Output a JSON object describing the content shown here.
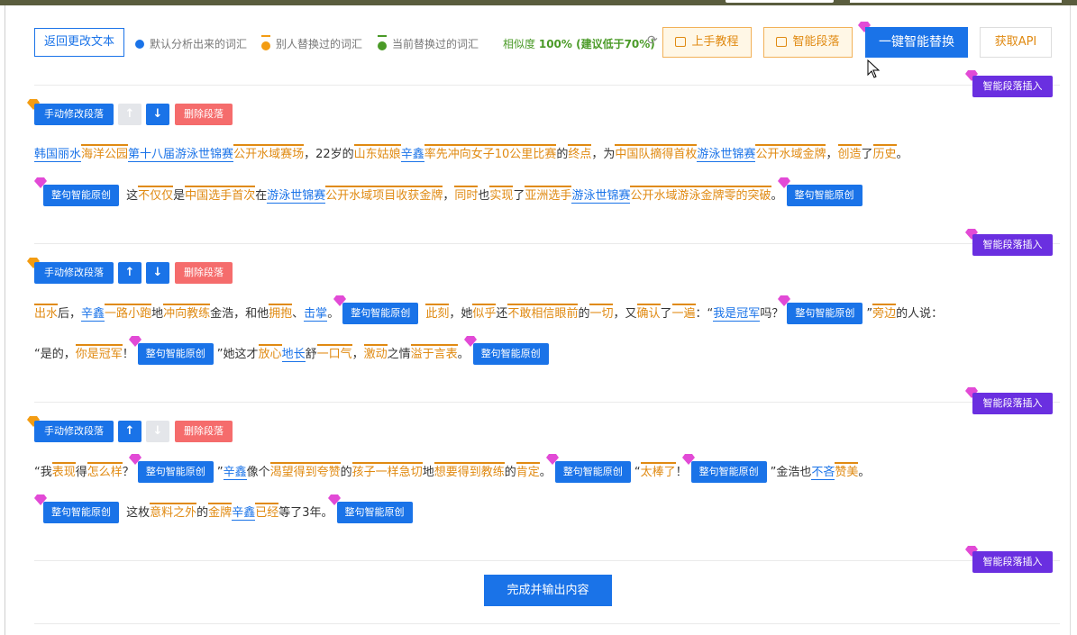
{
  "header": {
    "back_button": "返回更改文本",
    "legend": [
      {
        "label": "默认分析出来的词汇",
        "color": "#1a73e8"
      },
      {
        "label": "别人替换过的词汇",
        "color": "#f39c12"
      },
      {
        "label": "当前替换过的词汇",
        "color": "#4a9a27"
      }
    ],
    "similarity_prefix": "相似度",
    "similarity_value": "100% (建议低于70%)",
    "tutorial_button": "上手教程",
    "smart_paragraph_button": "智能段落",
    "one_click_replace_button": "一键智能替换",
    "get_api_button": "获取API"
  },
  "labels": {
    "insert_paragraph": "智能段落插入",
    "manual_edit": "手动修改段落",
    "delete_paragraph": "删除段落",
    "rewrite_sentence": "整句智能原创",
    "finish_output": "完成并输出内容"
  },
  "paragraphs": [
    {
      "lines": [
        [
          [
            "b",
            "韩国丽水"
          ],
          [
            "o",
            "海洋公园"
          ],
          [
            "b",
            "第十八届"
          ],
          [
            "b",
            "游泳世锦赛"
          ],
          [
            "o",
            "公开"
          ],
          [
            "o",
            "水域"
          ],
          [
            "o",
            "赛场"
          ],
          [
            "t",
            "，22岁的"
          ],
          [
            "o",
            "山东"
          ],
          [
            "o",
            "姑娘"
          ],
          [
            "b",
            "辛鑫"
          ],
          [
            "o",
            "率先"
          ],
          [
            "o",
            "冲向"
          ],
          [
            "o",
            "女子"
          ],
          [
            "o",
            "10"
          ],
          [
            "o",
            "公里"
          ],
          [
            "o",
            "比赛"
          ],
          [
            "t",
            "的"
          ],
          [
            "o",
            "终点"
          ],
          [
            "t",
            "，为"
          ],
          [
            "o",
            "中国队"
          ],
          [
            "o",
            "摘得"
          ],
          [
            "o",
            "首枚"
          ],
          [
            "b",
            "游泳世锦赛"
          ],
          [
            "o",
            "公开"
          ],
          [
            "o",
            "水域"
          ],
          [
            "o",
            "金牌"
          ],
          [
            "t",
            "，"
          ],
          [
            "o",
            "创造"
          ],
          [
            "t",
            "了"
          ],
          [
            "o",
            "历史"
          ],
          [
            "t",
            "。"
          ]
        ],
        [
          [
            "chip",
            ""
          ],
          [
            "t",
            " 这"
          ],
          [
            "o",
            "不仅仅"
          ],
          [
            "t",
            "是"
          ],
          [
            "o",
            "中国"
          ],
          [
            "o",
            "选手"
          ],
          [
            "o",
            "首次"
          ],
          [
            "t",
            "在"
          ],
          [
            "b",
            "游泳世锦赛"
          ],
          [
            "o",
            "公开"
          ],
          [
            "o",
            "水域"
          ],
          [
            "o",
            "项目"
          ],
          [
            "o",
            "收获"
          ],
          [
            "o",
            "金牌"
          ],
          [
            "t",
            "，"
          ],
          [
            "o",
            "同时"
          ],
          [
            "t",
            "也"
          ],
          [
            "o",
            "实现"
          ],
          [
            "t",
            "了"
          ],
          [
            "o",
            "亚洲"
          ],
          [
            "o",
            "选手"
          ],
          [
            "b",
            "游泳世锦赛"
          ],
          [
            "o",
            "公开"
          ],
          [
            "o",
            "水域"
          ],
          [
            "o",
            "游泳"
          ],
          [
            "o",
            "金牌"
          ],
          [
            "o",
            "零的突破"
          ],
          [
            "t",
            "。"
          ],
          [
            "chip",
            ""
          ]
        ]
      ]
    },
    {
      "lines": [
        [
          [
            "o",
            "出水"
          ],
          [
            "t",
            "后，"
          ],
          [
            "b",
            "辛鑫"
          ],
          [
            "o",
            "一路"
          ],
          [
            "o",
            "小跑"
          ],
          [
            "t",
            "地"
          ],
          [
            "o",
            "冲向"
          ],
          [
            "o",
            "教练"
          ],
          [
            "t",
            "金浩，和他"
          ],
          [
            "o",
            "拥抱"
          ],
          [
            "t",
            "、"
          ],
          [
            "b",
            "击掌"
          ],
          [
            "t",
            "。"
          ],
          [
            "chip",
            ""
          ],
          [
            "t",
            " "
          ],
          [
            "o",
            "此刻"
          ],
          [
            "t",
            "，她"
          ],
          [
            "o",
            "似乎"
          ],
          [
            "t",
            "还"
          ],
          [
            "o",
            "不敢"
          ],
          [
            "o",
            "相信"
          ],
          [
            "o",
            "眼前"
          ],
          [
            "t",
            "的"
          ],
          [
            "o",
            "一切"
          ],
          [
            "t",
            "，又"
          ],
          [
            "o",
            "确认"
          ],
          [
            "t",
            "了"
          ],
          [
            "o",
            "一遍"
          ],
          [
            "t",
            "：“"
          ],
          [
            "b",
            "我是冠军"
          ],
          [
            "t",
            "吗？"
          ],
          [
            "chip",
            ""
          ],
          [
            "t",
            "”"
          ],
          [
            "o",
            "旁边"
          ],
          [
            "t",
            "的人说："
          ]
        ],
        [
          [
            "t",
            "“是的，"
          ],
          [
            "o",
            "你是"
          ],
          [
            "o",
            "冠军"
          ],
          [
            "t",
            "！"
          ],
          [
            "chip",
            ""
          ],
          [
            "t",
            "”她这才"
          ],
          [
            "o",
            "放心"
          ],
          [
            "b",
            "地长"
          ],
          [
            "t",
            "舒"
          ],
          [
            "o",
            "一口气"
          ],
          [
            "t",
            "，"
          ],
          [
            "o",
            "激动"
          ],
          [
            "t",
            "之情"
          ],
          [
            "o",
            "溢于言表"
          ],
          [
            "t",
            "。"
          ],
          [
            "chip",
            ""
          ]
        ]
      ]
    },
    {
      "lines": [
        [
          [
            "t",
            "“我"
          ],
          [
            "o",
            "表现"
          ],
          [
            "t",
            "得"
          ],
          [
            "o",
            "怎么样"
          ],
          [
            "t",
            "？"
          ],
          [
            "chip",
            ""
          ],
          [
            "t",
            "”"
          ],
          [
            "b",
            "辛鑫"
          ],
          [
            "t",
            "像个"
          ],
          [
            "o",
            "渴望"
          ],
          [
            "o",
            "得到"
          ],
          [
            "o",
            "夸赞"
          ],
          [
            "t",
            "的"
          ],
          [
            "o",
            "孩子"
          ],
          [
            "o",
            "一样"
          ],
          [
            "o",
            "急切"
          ],
          [
            "t",
            "地"
          ],
          [
            "o",
            "想要"
          ],
          [
            "o",
            "得到"
          ],
          [
            "o",
            "教练"
          ],
          [
            "t",
            "的"
          ],
          [
            "o",
            "肯定"
          ],
          [
            "t",
            "。"
          ],
          [
            "chip",
            ""
          ],
          [
            "t",
            "“"
          ],
          [
            "o",
            "太棒了"
          ],
          [
            "t",
            "！"
          ],
          [
            "chip",
            ""
          ],
          [
            "t",
            "”金浩也"
          ],
          [
            "b",
            "不吝"
          ],
          [
            "o",
            "赞美"
          ],
          [
            "t",
            "。"
          ]
        ],
        [
          [
            "chip",
            ""
          ],
          [
            "t",
            " 这枚"
          ],
          [
            "o",
            "意料之外"
          ],
          [
            "t",
            "的"
          ],
          [
            "o",
            "金牌"
          ],
          [
            "b",
            "辛鑫"
          ],
          [
            "o",
            "已经"
          ],
          [
            "t",
            "等了3年。"
          ],
          [
            "chip",
            ""
          ]
        ]
      ]
    }
  ]
}
